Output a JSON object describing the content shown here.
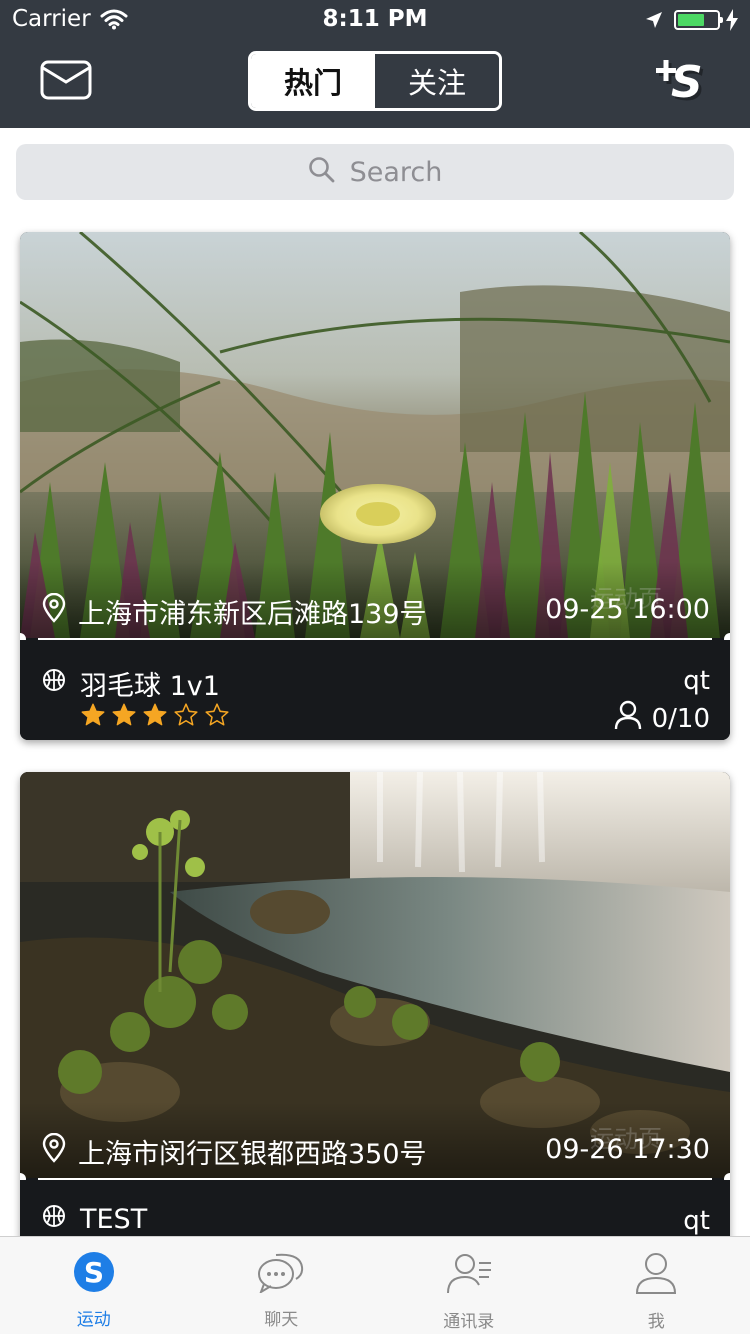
{
  "status_bar": {
    "carrier": "Carrier",
    "time": "8:11 PM",
    "battery_level": 0.6
  },
  "nav": {
    "tabs": [
      {
        "label": "热门",
        "active": true
      },
      {
        "label": "关注",
        "active": false
      }
    ],
    "mail_icon": "envelope-icon",
    "add_icon": "plus-s-logo-icon"
  },
  "search": {
    "placeholder": "Search"
  },
  "cards": [
    {
      "address": "上海市浦东新区后滩路139号",
      "datetime": "09-25 16:00",
      "sport": "羽毛球 1v1",
      "owner": "qt",
      "rating": 3,
      "rating_max": 5,
      "participants": "0/10"
    },
    {
      "address": "上海市闵行区银都西路350号",
      "datetime": "09-26 17:30",
      "sport": "TEST",
      "owner": "qt"
    }
  ],
  "tabbar": {
    "items": [
      {
        "label": "运动",
        "icon": "sport-s-icon",
        "active": true
      },
      {
        "label": "聊天",
        "icon": "chat-bubbles-icon",
        "active": false
      },
      {
        "label": "通讯录",
        "icon": "contacts-icon",
        "active": false
      },
      {
        "label": "我",
        "icon": "person-icon",
        "active": false
      }
    ]
  },
  "colors": {
    "navbar": "#343a42",
    "accent": "#1e7ee6",
    "star": "#f5a623",
    "card_info": "#17191c"
  }
}
